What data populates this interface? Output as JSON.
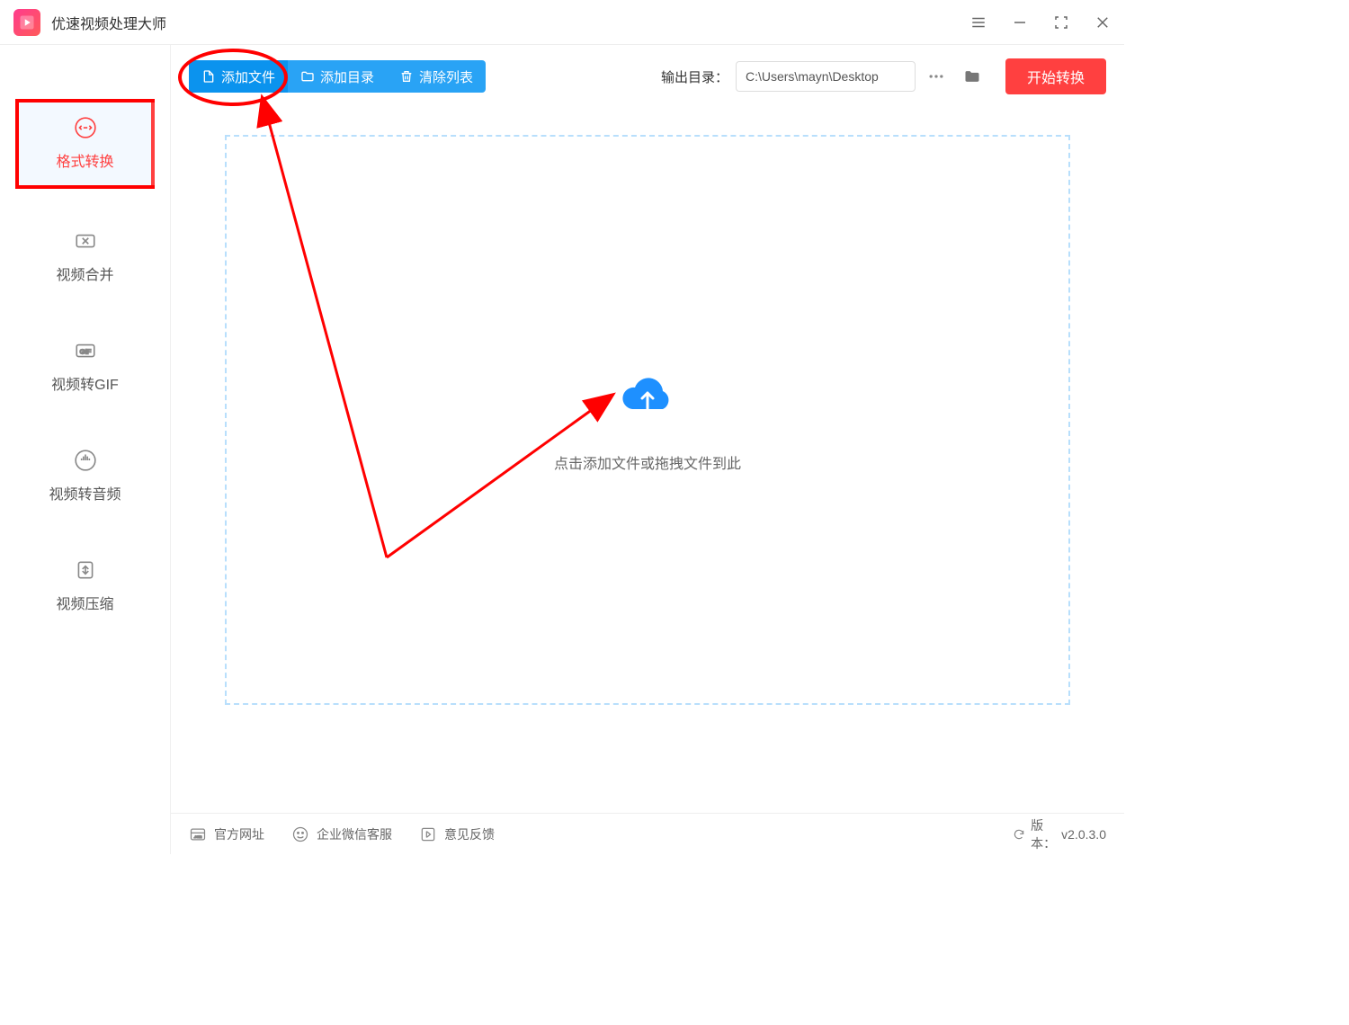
{
  "app": {
    "title": "优速视频处理大师"
  },
  "sidebar": {
    "items": [
      {
        "label": "格式转换"
      },
      {
        "label": "视频合并"
      },
      {
        "label": "视频转GIF"
      },
      {
        "label": "视频转音频"
      },
      {
        "label": "视频压缩"
      }
    ]
  },
  "toolbar": {
    "add_file": "添加文件",
    "add_folder": "添加目录",
    "clear_list": "清除列表",
    "output_label": "输出目录：",
    "output_path": "C:\\Users\\mayn\\Desktop",
    "start": "开始转换"
  },
  "dropzone": {
    "text": "点击添加文件或拖拽文件到此"
  },
  "statusbar": {
    "official": "官方网址",
    "wechat": "企业微信客服",
    "feedback": "意见反馈",
    "version_label": "版本：",
    "version": "v2.0.3.0"
  }
}
